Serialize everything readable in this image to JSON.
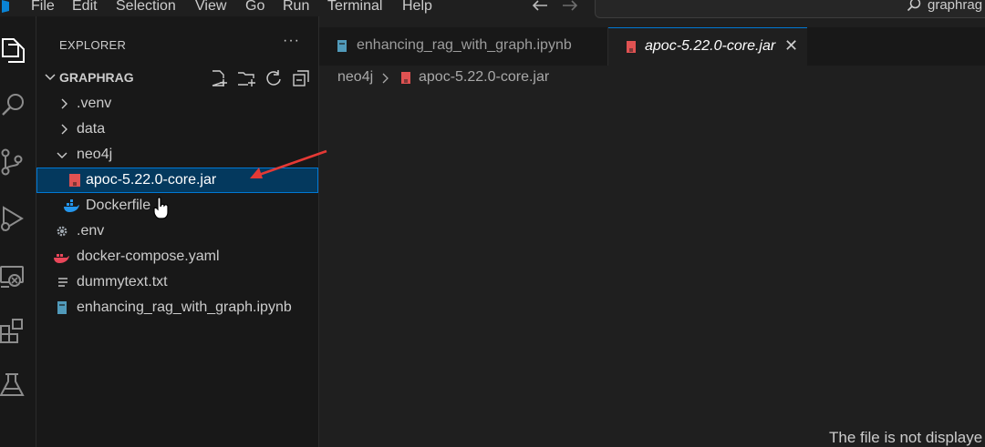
{
  "menu": {
    "items": [
      "File",
      "Edit",
      "Selection",
      "View",
      "Go",
      "Run",
      "Terminal",
      "Help"
    ]
  },
  "command_center": {
    "text": "graphrag",
    "icon": "search-icon"
  },
  "activity_bar": {
    "icons": [
      "explorer-icon",
      "search-icon",
      "source-control-icon",
      "run-debug-icon",
      "remote-explorer-icon",
      "extensions-icon",
      "testing-icon"
    ]
  },
  "sidebar": {
    "title": "EXPLORER",
    "more_label": "···",
    "folder": "GRAPHRAG",
    "tree": [
      {
        "label": ".venv",
        "kind": "folder-collapsed"
      },
      {
        "label": "data",
        "kind": "folder-collapsed"
      },
      {
        "label": "neo4j",
        "kind": "folder-expanded"
      },
      {
        "label": "apoc-5.22.0-core.jar",
        "kind": "jar-file",
        "selected": true
      },
      {
        "label": "Dockerfile",
        "kind": "docker-file"
      },
      {
        "label": ".env",
        "kind": "env-file"
      },
      {
        "label": "docker-compose.yaml",
        "kind": "compose-file"
      },
      {
        "label": "dummytext.txt",
        "kind": "text-file"
      },
      {
        "label": "enhancing_rag_with_graph.ipynb",
        "kind": "notebook-file"
      }
    ]
  },
  "editor": {
    "tabs": [
      {
        "label": "enhancing_rag_with_graph.ipynb",
        "active": false,
        "icon": "notebook-icon"
      },
      {
        "label": "apoc-5.22.0-core.jar",
        "active": true,
        "icon": "jar-icon"
      }
    ],
    "tab_close": "✕",
    "breadcrumb": [
      "neo4j",
      "apoc-5.22.0-core.jar"
    ],
    "message": "The file is not displaye"
  },
  "colors": {
    "accent": "#0078d4",
    "selection": "#04395e",
    "jar_red": "#e05252",
    "notebook_blue": "#519aba",
    "docker_blue": "#2496ed",
    "annotation_red": "#e53935"
  }
}
